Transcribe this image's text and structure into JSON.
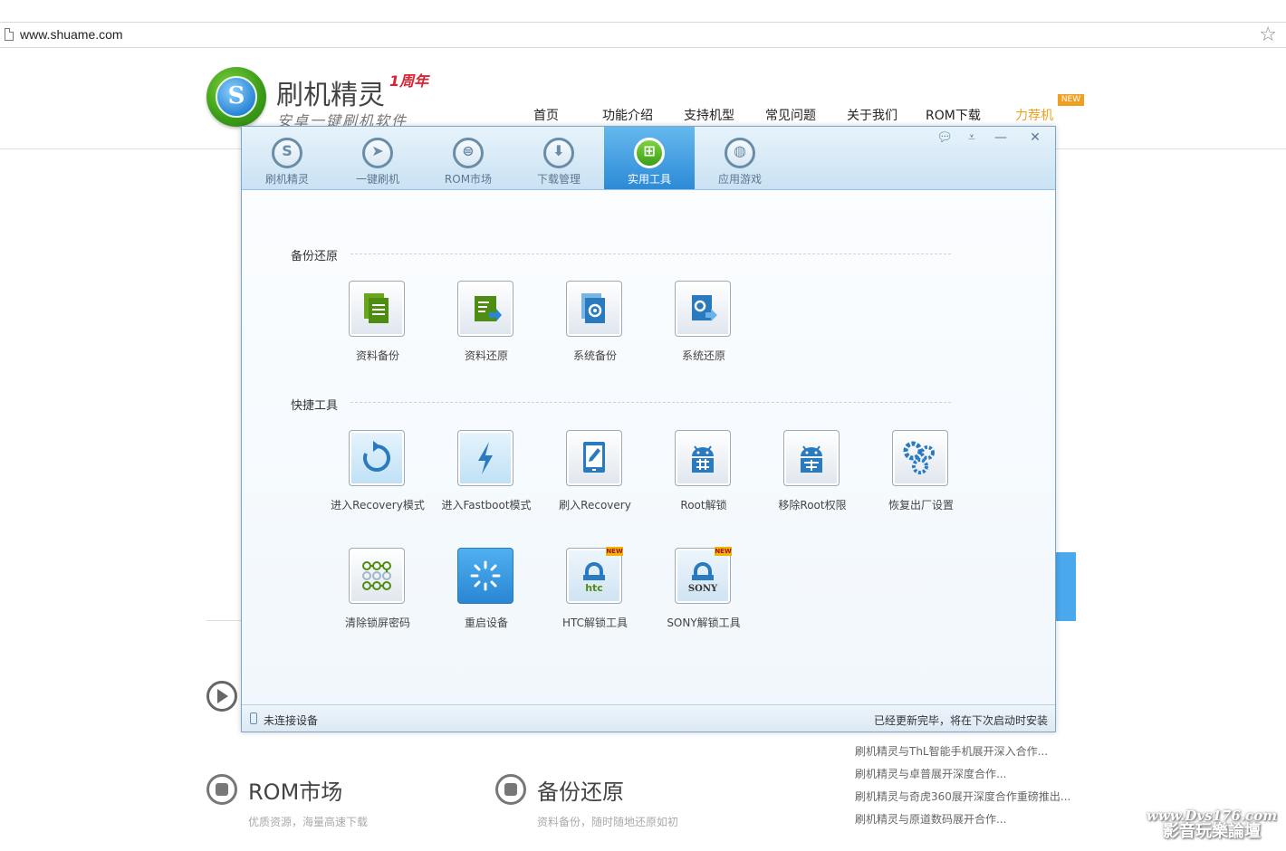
{
  "browser": {
    "url": "www.shuame.com"
  },
  "site": {
    "title": "刷机精灵",
    "anniversary": "1周年",
    "subtitle": "安卓一键刷机软件",
    "nav": [
      "首页",
      "功能介绍",
      "支持机型",
      "常见问题",
      "关于我们",
      "ROM下载",
      "力荐机"
    ],
    "nav_new_badge": "NEW",
    "features": [
      {
        "title": "ROM市场",
        "desc": "优质资源，海量高速下载"
      },
      {
        "title": "备份还原",
        "desc": "资料备份，随时随地还原如初"
      }
    ],
    "news": [
      "刷机精灵与ThL智能手机展开深入合作...",
      "刷机精灵与卓普展开深度合作...",
      "刷机精灵与奇虎360展开深度合作重磅推出...",
      "刷机精灵与原道数码展开合作..."
    ],
    "watermark": {
      "line1": "www.Dvs176.com",
      "line2": "影音玩樂論壇"
    }
  },
  "app": {
    "tabs": [
      {
        "label": "刷机精灵",
        "icon": "s-logo-icon"
      },
      {
        "label": "一键刷机",
        "icon": "cursor-icon"
      },
      {
        "label": "ROM市场",
        "icon": "android-icon"
      },
      {
        "label": "下载管理",
        "icon": "download-icon"
      },
      {
        "label": "实用工具",
        "icon": "grid-icon",
        "active": true
      },
      {
        "label": "应用游戏",
        "icon": "ball-icon"
      }
    ],
    "sections": {
      "backup": {
        "title": "备份还原",
        "tools": [
          "资料备份",
          "资料还原",
          "系统备份",
          "系统还原"
        ]
      },
      "quick": {
        "title": "快捷工具",
        "tools": [
          "进入Recovery模式",
          "进入Fastboot模式",
          "刷入Recovery",
          "Root解锁",
          "移除Root权限",
          "恢复出厂设置",
          "清除锁屏密码",
          "重启设备",
          "HTC解锁工具",
          "SONY解锁工具"
        ]
      }
    },
    "icon_texts": {
      "htc": "htc",
      "sony": "SONY",
      "new": "NEW"
    },
    "status": {
      "left": "未连接设备",
      "right": "已经更新完毕，将在下次启动时安装"
    },
    "colors": {
      "accent_blue": "#2c8ad6",
      "accent_green": "#3c9e18",
      "new_orange": "#f0a020"
    }
  }
}
